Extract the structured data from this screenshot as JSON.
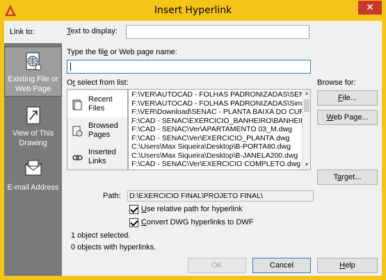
{
  "window": {
    "title": "Insert Hyperlink",
    "close_glyph": "✕",
    "app_icon": "autocad-a-icon"
  },
  "link_to": {
    "label": "Link to:",
    "items": [
      {
        "label_line1": "Existing File or",
        "label_line2": "Web Page",
        "icon": "globe-file-icon"
      },
      {
        "label_line1": "View of This",
        "label_line2": "Drawing",
        "icon": "drawing-view-icon"
      },
      {
        "label_line1": "E-mail Address",
        "label_line2": "",
        "icon": "envelope-icon"
      }
    ]
  },
  "text_to_display": {
    "label_pre": "",
    "label_mnemonic": "T",
    "label_post": "ext to display:",
    "value": ""
  },
  "file_name": {
    "label_pre": "Type the fil",
    "label_mnemonic": "e",
    "label_post": " or Web page name:",
    "value": ""
  },
  "select_from_list": {
    "label_pre": "O",
    "label_mnemonic": "r",
    "label_post": " select from list:",
    "tabs": [
      {
        "line1": "Recent",
        "line2": "Files",
        "icon": "recent-files-icon"
      },
      {
        "line1": "Browsed",
        "line2": "Pages",
        "icon": "browsed-pages-icon"
      },
      {
        "line1": "Inserted",
        "line2": "Links",
        "icon": "inserted-links-icon"
      }
    ],
    "items": [
      "F:\\VER\\AUTOCAD - FOLHAS PADRONIZADAS\\SENAC",
      "F:\\VER\\AUTOCAD - FOLHAS PADRONIZADAS\\Simbolos",
      "F:\\VER\\Download\\SENAC - PLANTA BAIXA DO CURSO",
      "F:\\CAD - SENAC\\EXERCICIO_BANHEIRO\\BANHEIRO",
      "F:\\CAD - SENAC\\Ver\\APARTAMENTO 03_M.dwg",
      "F:\\CAD - SENAC\\Ver\\EXERCICIO_PLANTA.dwg",
      "C:\\Users\\Max Siqueira\\Desktop\\B-PORTA80.dwg",
      "C:\\Users\\Max Siqueira\\Desktop\\B-JANELA200.dwg",
      "F:\\CAD - SENAC\\Ver\\EXERCICIO COMPLETO.dwg"
    ]
  },
  "browse_for": {
    "label": "Browse for:",
    "file_button": "File...",
    "file_mnemonic": "F",
    "web_button": "Web Page...",
    "web_mnemonic": "W"
  },
  "target_button": {
    "pre": "T",
    "mnemonic": "a",
    "post": "rget..."
  },
  "path": {
    "label": "Path:",
    "value": "D:\\EXERCICIO FINAL\\PROJETO FINAL\\"
  },
  "options": {
    "relative": {
      "mnemonic": "U",
      "rest": "se relative path for hyperlink",
      "checked": true
    },
    "convert": {
      "mnemonic": "C",
      "rest": "onvert DWG hyperlinks to DWF",
      "checked": true
    }
  },
  "status": {
    "selected": "1 object selected.",
    "with_links": "0 objects with hyperlinks."
  },
  "buttons": {
    "ok": "OK",
    "cancel": "Cancel",
    "help_mnemonic": "H",
    "help_rest": "elp"
  },
  "colors": {
    "title_bar": "#f4c418",
    "close": "#c7392a",
    "left_bar": "#7a7a7a",
    "focus": "#2f76c9"
  }
}
